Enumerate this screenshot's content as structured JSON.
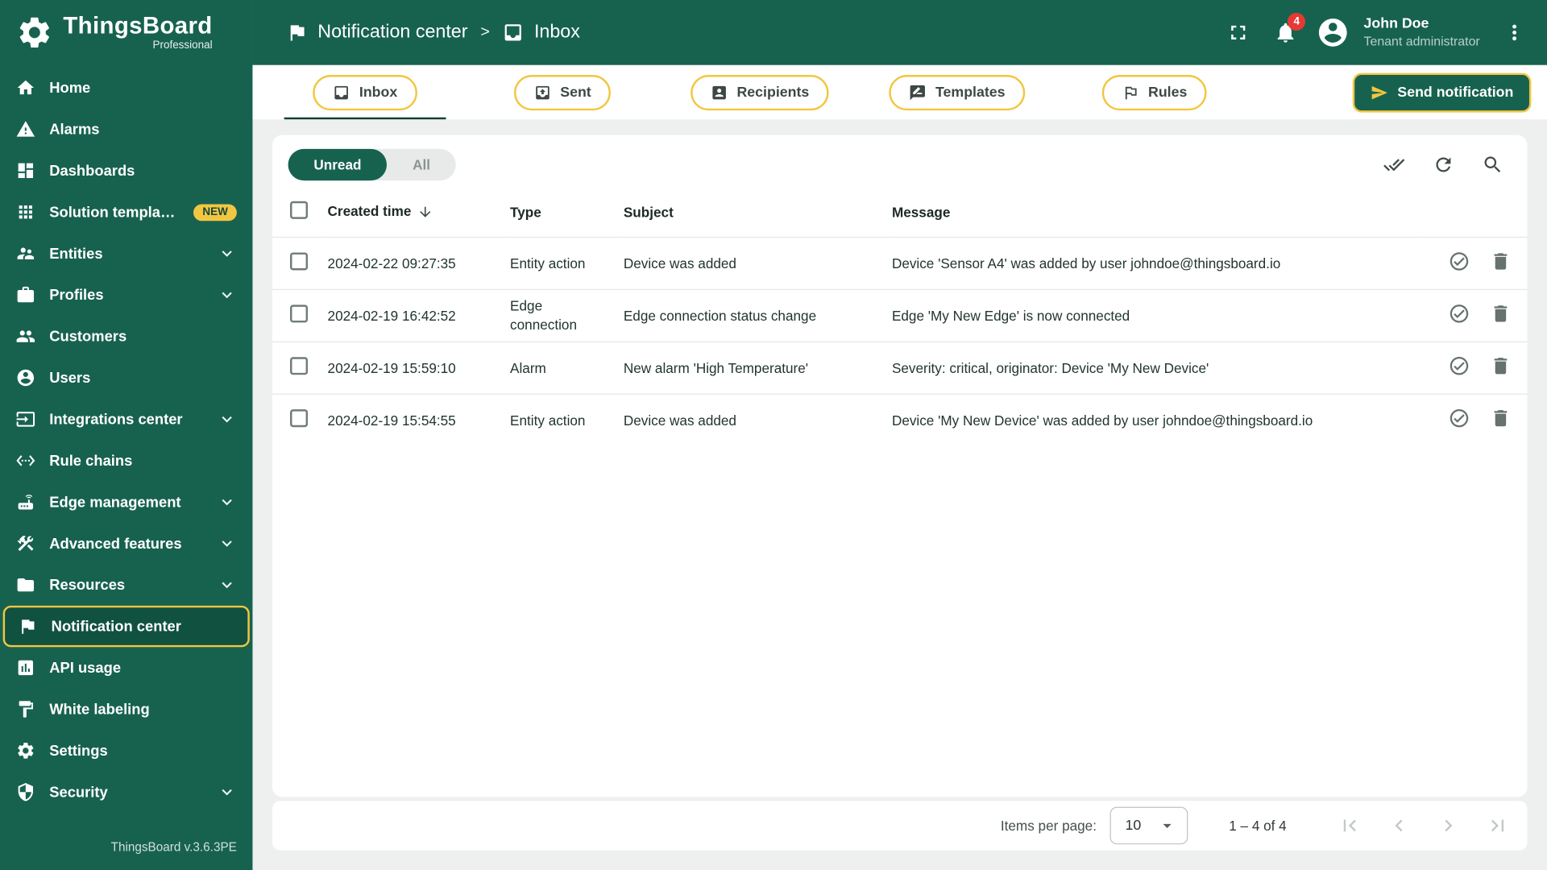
{
  "app": {
    "logo_title": "ThingsBoard",
    "logo_subtitle": "Professional",
    "version": "ThingsBoard v.3.6.3PE"
  },
  "colors": {
    "brand_green": "#17624F",
    "accent_yellow": "#F2C641",
    "badge_red": "#E53935"
  },
  "header": {
    "breadcrumb": [
      {
        "label": "Notification center",
        "icon": "flag"
      },
      {
        "label": "Inbox",
        "icon": "inbox"
      }
    ],
    "separator": ">",
    "notifications_count": "4",
    "user": {
      "name": "John Doe",
      "role": "Tenant administrator"
    }
  },
  "sidebar": {
    "items": [
      {
        "label": "Home",
        "icon": "home"
      },
      {
        "label": "Alarms",
        "icon": "warning"
      },
      {
        "label": "Dashboards",
        "icon": "dashboard"
      },
      {
        "label": "Solution templates",
        "icon": "apps",
        "badge": "NEW"
      },
      {
        "label": "Entities",
        "icon": "entities",
        "expandable": true
      },
      {
        "label": "Profiles",
        "icon": "briefcase",
        "expandable": true
      },
      {
        "label": "Customers",
        "icon": "group"
      },
      {
        "label": "Users",
        "icon": "person"
      },
      {
        "label": "Integrations center",
        "icon": "input",
        "expandable": true
      },
      {
        "label": "Rule chains",
        "icon": "ethernet"
      },
      {
        "label": "Edge management",
        "icon": "router",
        "expandable": true
      },
      {
        "label": "Advanced features",
        "icon": "tools",
        "expandable": true
      },
      {
        "label": "Resources",
        "icon": "folder",
        "expandable": true
      },
      {
        "label": "Notification center",
        "icon": "flag",
        "active": true
      },
      {
        "label": "API usage",
        "icon": "chart"
      },
      {
        "label": "White labeling",
        "icon": "paint"
      },
      {
        "label": "Settings",
        "icon": "gear"
      },
      {
        "label": "Security",
        "icon": "shield",
        "expandable": true
      }
    ]
  },
  "tabs": [
    {
      "label": "Inbox",
      "icon": "inbox",
      "active": true
    },
    {
      "label": "Sent",
      "icon": "outbox"
    },
    {
      "label": "Recipients",
      "icon": "contact"
    },
    {
      "label": "Templates",
      "icon": "message-edit"
    },
    {
      "label": "Rules",
      "icon": "flag-outline"
    }
  ],
  "send_notification": {
    "label": "Send notification",
    "icon": "send"
  },
  "filter": {
    "options": [
      {
        "label": "Unread",
        "active": true
      },
      {
        "label": "All",
        "active": false
      }
    ]
  },
  "toolbar_actions": [
    {
      "name": "mark-all-as-read",
      "icon": "done-all"
    },
    {
      "name": "refresh",
      "icon": "refresh"
    },
    {
      "name": "search",
      "icon": "search"
    }
  ],
  "table": {
    "columns": [
      "Created time",
      "Type",
      "Subject",
      "Message"
    ],
    "sort": {
      "column": "Created time",
      "direction": "desc"
    },
    "rows": [
      {
        "created_time": "2024-02-22 09:27:35",
        "type": "Entity action",
        "subject": "Device was added",
        "message": "Device 'Sensor A4' was added by user johndoe@thingsboard.io"
      },
      {
        "created_time": "2024-02-19 16:42:52",
        "type": "Edge connection",
        "subject": "Edge connection status change",
        "message": "Edge 'My New Edge' is now connected"
      },
      {
        "created_time": "2024-02-19 15:59:10",
        "type": "Alarm",
        "subject": "New alarm 'High Temperature'",
        "message": "Severity: critical, originator: Device 'My New Device'"
      },
      {
        "created_time": "2024-02-19 15:54:55",
        "type": "Entity action",
        "subject": "Device was added",
        "message": "Device 'My New Device' was added by user johndoe@thingsboard.io"
      }
    ]
  },
  "pagination": {
    "items_per_page_label": "Items per page:",
    "items_per_page_value": "10",
    "range": "1 – 4 of 4"
  }
}
